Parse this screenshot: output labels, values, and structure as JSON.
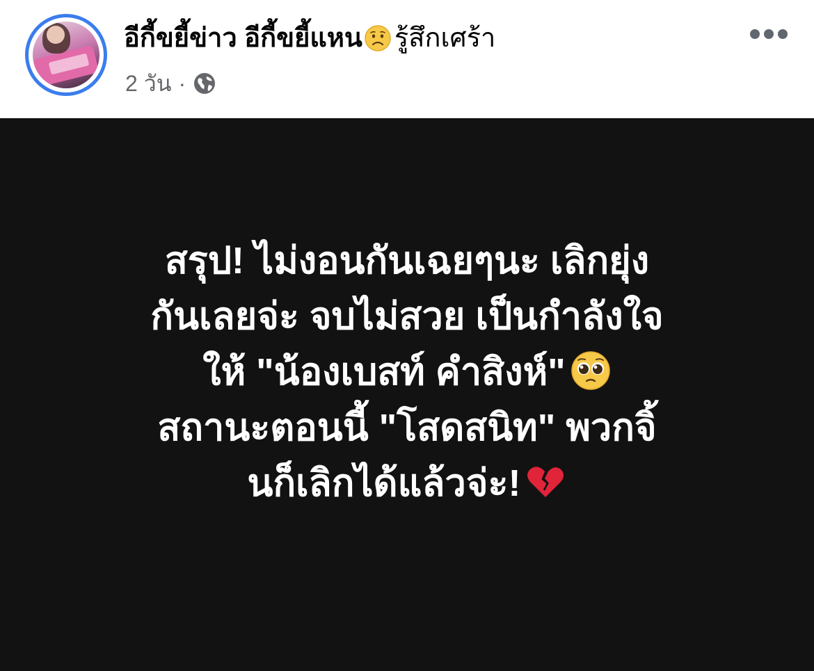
{
  "post": {
    "author": {
      "name": "อีกี้ขยี้ข่าว อีกี้ขยี้แหน",
      "feeling_icon": "sad-face-emoji",
      "feeling": "รู้สึกเศร้า"
    },
    "meta": {
      "time": "2 วัน",
      "separator": "·",
      "privacy_icon": "globe-icon"
    },
    "more_icon": "more-options-icon",
    "colors": {
      "avatar_ring": "#3b7ded",
      "name_text": "#050505",
      "meta_text": "#65676b",
      "body_background": "#121212",
      "body_text": "#ffffff"
    },
    "body": {
      "lines": [
        "สรุป! ไม่งอนกันเฉยๆนะ เลิกยุ่ง",
        "กันเลยจ่ะ จบไม่สวย เป็นกำลังใจ",
        "ให้ \"น้องเบสท์ คำสิงห์\"",
        "สถานะตอนนี้ \"โสดสนิท\" พวกจิ้",
        "นก็เลิกได้แล้วจ่ะ!"
      ],
      "line3_emoji": "pleading-face-emoji",
      "line5_emoji": "broken-heart-emoji"
    }
  }
}
